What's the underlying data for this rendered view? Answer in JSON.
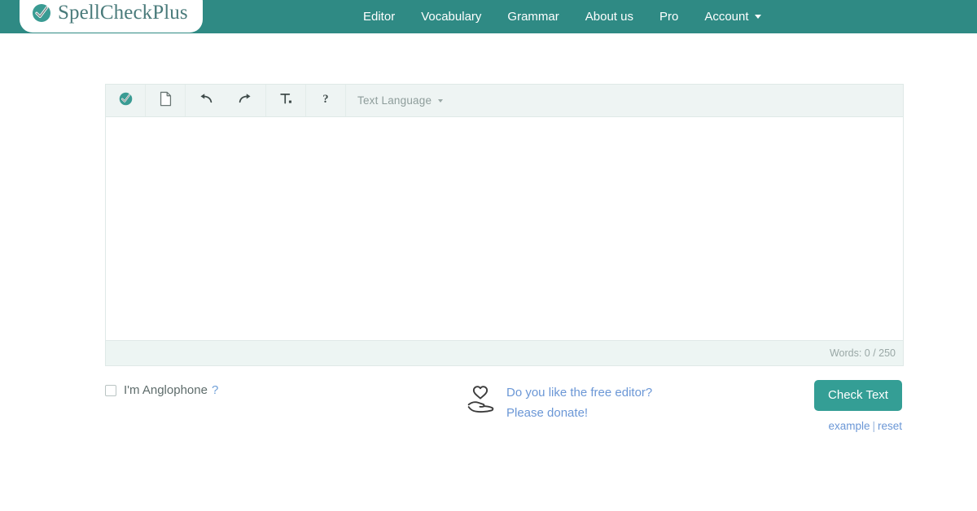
{
  "header": {
    "brand": "SpellCheckPlus",
    "brand_icon": "check-circle-icon",
    "nav": [
      {
        "label": "Editor",
        "icon": ""
      },
      {
        "label": "Vocabulary",
        "icon": ""
      },
      {
        "label": "Grammar",
        "icon": ""
      },
      {
        "label": "About us",
        "icon": ""
      },
      {
        "label": "Pro",
        "icon": ""
      },
      {
        "label": "Account",
        "icon": "chevron-down-icon"
      }
    ],
    "colors": {
      "bar": "#2f8a84",
      "brand_text": "#4a7b7b"
    }
  },
  "editor": {
    "toolbar": {
      "check_icon": "check-circle-icon",
      "new_doc_icon": "document-icon",
      "undo_icon": "undo-arrow-icon",
      "redo_icon": "redo-arrow-icon",
      "clear_format_icon": "remove-formatting-icon",
      "help_icon": "question-mark-icon",
      "language_label": "Text Language",
      "language_caret": "caret-down-icon"
    },
    "content": "",
    "placeholder": "",
    "status": {
      "word_count": "Words: 0 / 250"
    }
  },
  "bottom": {
    "anglophone": {
      "label": "I'm Anglophone",
      "help": "?",
      "checked": false
    },
    "donate": {
      "icon": "hand-holding-heart-icon",
      "line1": "Do you like the free editor?",
      "line2": "Please donate!"
    },
    "actions": {
      "check_label": "Check Text",
      "example_label": "example",
      "separator": "|",
      "reset_label": "reset"
    }
  },
  "colors": {
    "teal": "#2f8a84",
    "button_teal": "#349e95",
    "link_blue": "#6b97d6",
    "toolbar_bg": "#eef4f3",
    "status_bg": "#edf5f3",
    "border": "#dfe9e7"
  }
}
